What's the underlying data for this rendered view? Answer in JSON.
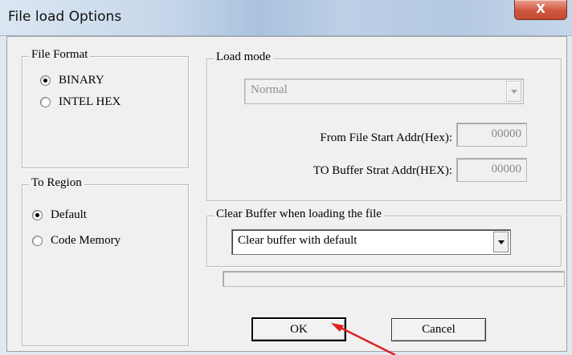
{
  "window": {
    "title": "File load Options",
    "close_label": "X"
  },
  "file_format": {
    "legend": "File Format",
    "options": [
      {
        "label": "BINARY",
        "selected": true
      },
      {
        "label": "INTEL HEX",
        "selected": false
      }
    ]
  },
  "to_region": {
    "legend": "To Region",
    "options": [
      {
        "label": "Default",
        "selected": true
      },
      {
        "label": "Code Memory",
        "selected": false
      }
    ]
  },
  "load_mode": {
    "legend": "Load mode",
    "mode_value": "Normal",
    "from_label": "From File Start Addr(Hex):",
    "from_value": "00000",
    "to_label": "TO Buffer Strat Addr(HEX):",
    "to_value": "00000"
  },
  "clear_buffer": {
    "legend": "Clear Buffer when loading the file",
    "value": "Clear buffer with default"
  },
  "buttons": {
    "ok": "OK",
    "cancel": "Cancel"
  },
  "colors": {
    "annotation_arrow": "#e02020"
  }
}
